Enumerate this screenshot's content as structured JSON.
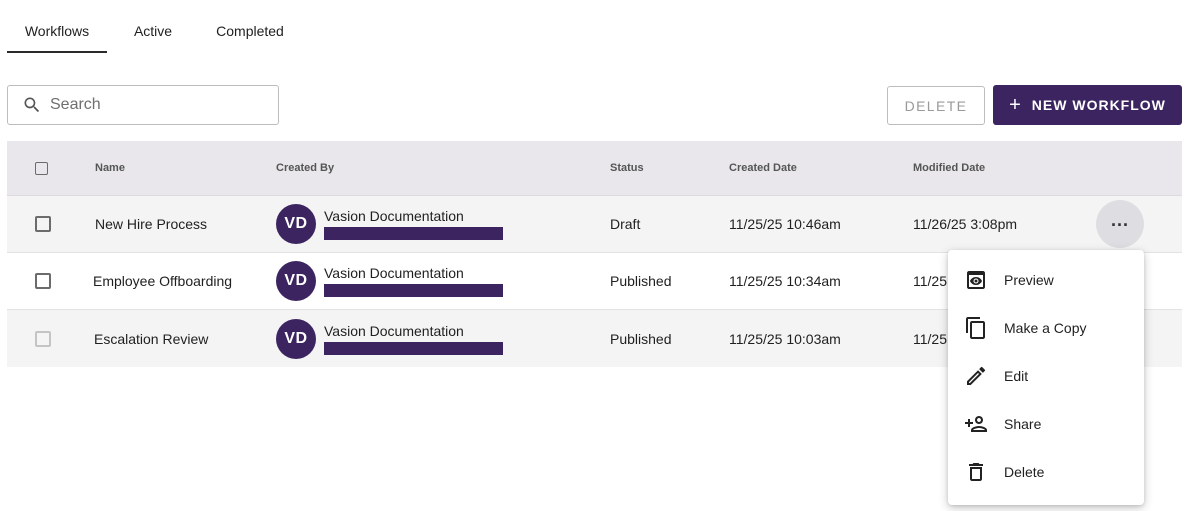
{
  "tabs": [
    {
      "label": "Workflows"
    },
    {
      "label": "Active"
    },
    {
      "label": "Completed"
    }
  ],
  "search": {
    "placeholder": "Search",
    "icon": "search-icon"
  },
  "toolbar": {
    "delete_label": "DELETE",
    "new_label": "NEW WORKFLOW"
  },
  "table": {
    "headers": {
      "name": "Name",
      "created_by": "Created By",
      "status": "Status",
      "created_date": "Created Date",
      "modified_date": "Modified Date"
    },
    "rows": [
      {
        "name": "New Hire Process",
        "initials": "VD",
        "created_by": "Vasion Documentation",
        "status": "Draft",
        "created_date": "11/25/25 10:46am",
        "modified_date": "11/26/25 3:08pm"
      },
      {
        "name": "Employee Offboarding",
        "initials": "VD",
        "created_by": "Vasion Documentation",
        "status": "Published",
        "created_date": "11/25/25 10:34am",
        "modified_date": "11/25"
      },
      {
        "name": "Escalation Review",
        "initials": "VD",
        "created_by": "Vasion Documentation",
        "status": "Published",
        "created_date": "11/25/25 10:03am",
        "modified_date": "11/25"
      }
    ]
  },
  "menu": {
    "items": [
      {
        "label": "Preview",
        "icon": "preview-icon"
      },
      {
        "label": "Make a Copy",
        "icon": "copy-icon"
      },
      {
        "label": "Edit",
        "icon": "edit-icon"
      },
      {
        "label": "Share",
        "icon": "share-icon"
      },
      {
        "label": "Delete",
        "icon": "delete-icon"
      }
    ]
  },
  "colors": {
    "accent": "#3b2460",
    "header_bg": "#e9e7eb"
  }
}
